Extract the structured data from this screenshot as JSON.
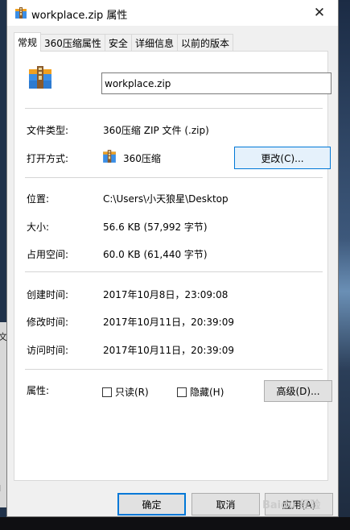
{
  "window": {
    "title": "workplace.zip 属性",
    "close_glyph": "✕"
  },
  "tabs": [
    {
      "label": "常规",
      "active": true
    },
    {
      "label": "360压缩属性",
      "active": false
    },
    {
      "label": "安全",
      "active": false
    },
    {
      "label": "详细信息",
      "active": false
    },
    {
      "label": "以前的版本",
      "active": false
    }
  ],
  "general": {
    "file_name": "workplace.zip",
    "file_type_label": "文件类型:",
    "file_type_value": "360压缩 ZIP 文件 (.zip)",
    "open_with_label": "打开方式:",
    "open_with_value": "360压缩",
    "change_button": "更改(C)...",
    "location_label": "位置:",
    "location_value": "C:\\Users\\小天狼星\\Desktop",
    "size_label": "大小:",
    "size_value": "56.6 KB (57,992 字节)",
    "disk_size_label": "占用空间:",
    "disk_size_value": "60.0 KB (61,440 字节)",
    "created_label": "创建时间:",
    "created_value": "2017年10月8日，23:09:08",
    "modified_label": "修改时间:",
    "modified_value": "2017年10月11日，20:39:09",
    "accessed_label": "访问时间:",
    "accessed_value": "2017年10月11日，20:39:09",
    "attributes_label": "属性:",
    "readonly_label": "只读(R)",
    "readonly_checked": false,
    "hidden_label": "隐藏(H)",
    "hidden_checked": false,
    "advanced_button": "高级(D)..."
  },
  "footer": {
    "ok_button": "确定",
    "cancel_button": "取消",
    "apply_button": "应用(A)"
  },
  "background": {
    "left_text_1": "文",
    "left_text_2": "I"
  },
  "watermark": "Baidu 经验",
  "colors": {
    "accent": "#0078d7",
    "zip_icon_blue": "#3a8ee6",
    "zip_icon_orange": "#f0a020"
  },
  "icons": {
    "title": "zip-archive-icon",
    "large": "zip-archive-icon",
    "open_with": "zip-archive-icon",
    "close": "close-icon"
  }
}
